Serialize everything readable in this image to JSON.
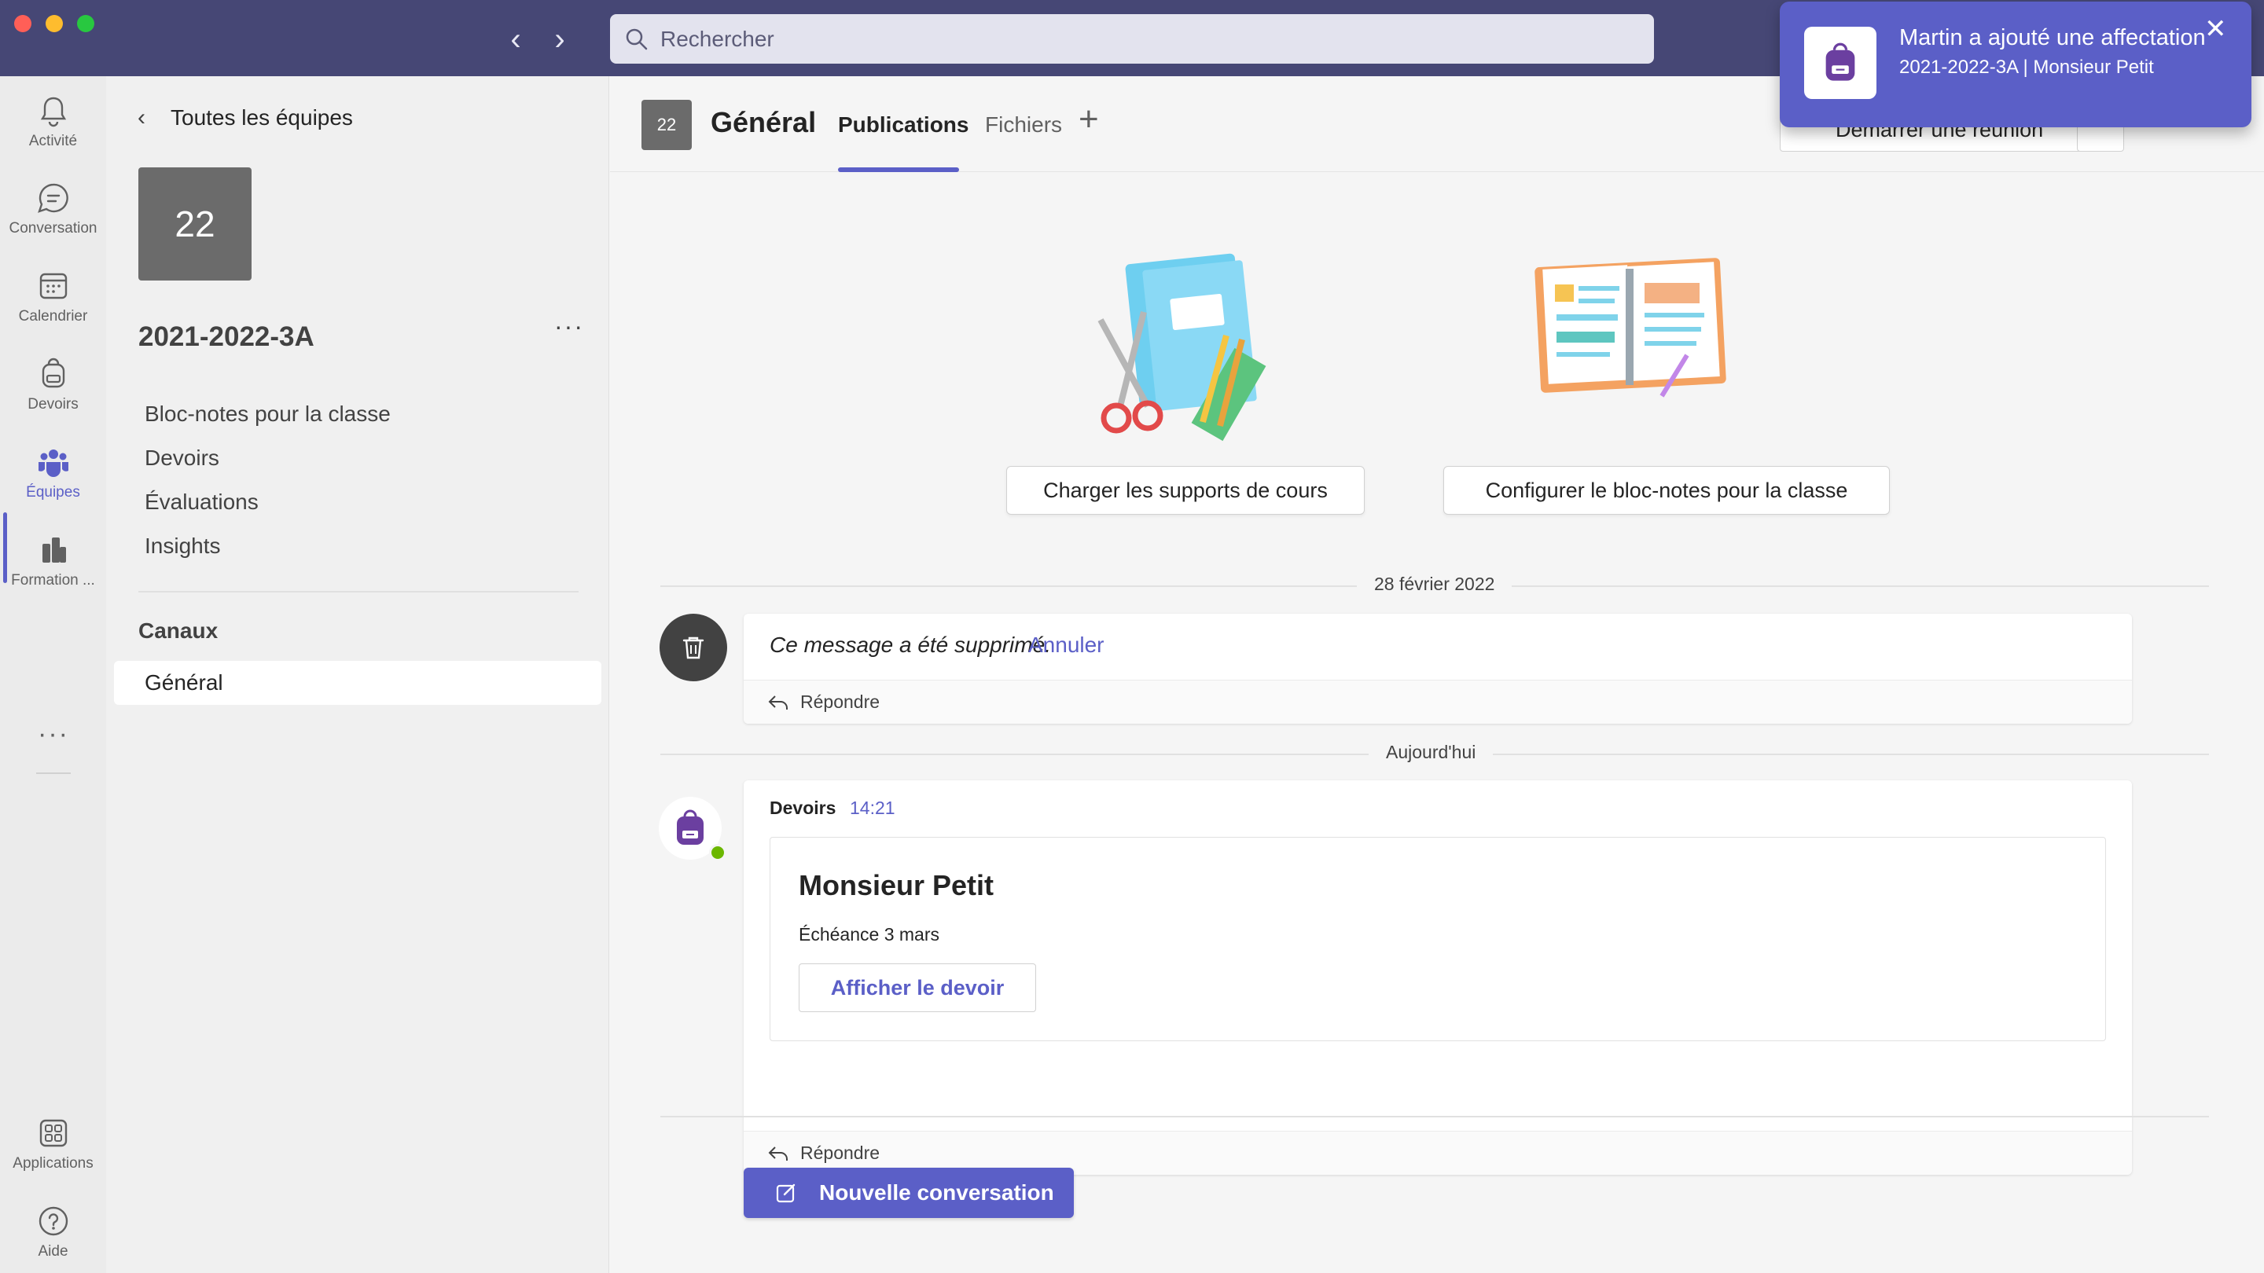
{
  "window": {
    "search_placeholder": "Rechercher"
  },
  "rail": {
    "items": [
      {
        "label": "Activité",
        "icon": "bell-icon"
      },
      {
        "label": "Conversation",
        "icon": "chat-icon"
      },
      {
        "label": "Calendrier",
        "icon": "calendar-icon"
      },
      {
        "label": "Devoirs",
        "icon": "backpack-icon"
      },
      {
        "label": "Équipes",
        "icon": "teams-icon"
      },
      {
        "label": "Formation ...",
        "icon": "book-icon"
      },
      {
        "label": "Applications",
        "icon": "apps-icon"
      },
      {
        "label": "Aide",
        "icon": "help-icon"
      }
    ],
    "more": "···",
    "active": "Équipes"
  },
  "team_panel": {
    "back_label": "Toutes les équipes",
    "avatar_text": "22",
    "team_name": "2021-2022-3A",
    "more": "···",
    "links": [
      "Bloc-notes pour la classe",
      "Devoirs",
      "Évaluations",
      "Insights"
    ],
    "channels_label": "Canaux",
    "channels": [
      "Général"
    ]
  },
  "header": {
    "avatar_text": "22",
    "channel_title": "Général",
    "tabs": [
      "Publications",
      "Fichiers"
    ],
    "active_tab": "Publications",
    "add_tab": "+",
    "meet_button": "Démarrer une réunion"
  },
  "actions": {
    "upload_materials": "Charger les supports de cours",
    "setup_notebook": "Configurer le bloc-notes pour la classe"
  },
  "feed": {
    "date1": "28 février 2022",
    "deleted_message": "Ce message a été supprimé.",
    "undo": "Annuler",
    "reply": "Répondre",
    "date2": "Aujourd'hui",
    "post": {
      "sender": "Devoirs",
      "time": "14:21",
      "title": "Monsieur Petit",
      "due": "Échéance 3 mars",
      "view_button": "Afficher le devoir",
      "reply": "Répondre"
    },
    "new_conversation": "Nouvelle conversation"
  },
  "toast": {
    "title": "Martin a ajouté une affectation",
    "subtitle": "2021-2022-3A | Monsieur Petit",
    "close": "✕"
  },
  "colors": {
    "accent": "#5b5fc7",
    "titlebar": "#464775",
    "presence": "#6bb700"
  }
}
